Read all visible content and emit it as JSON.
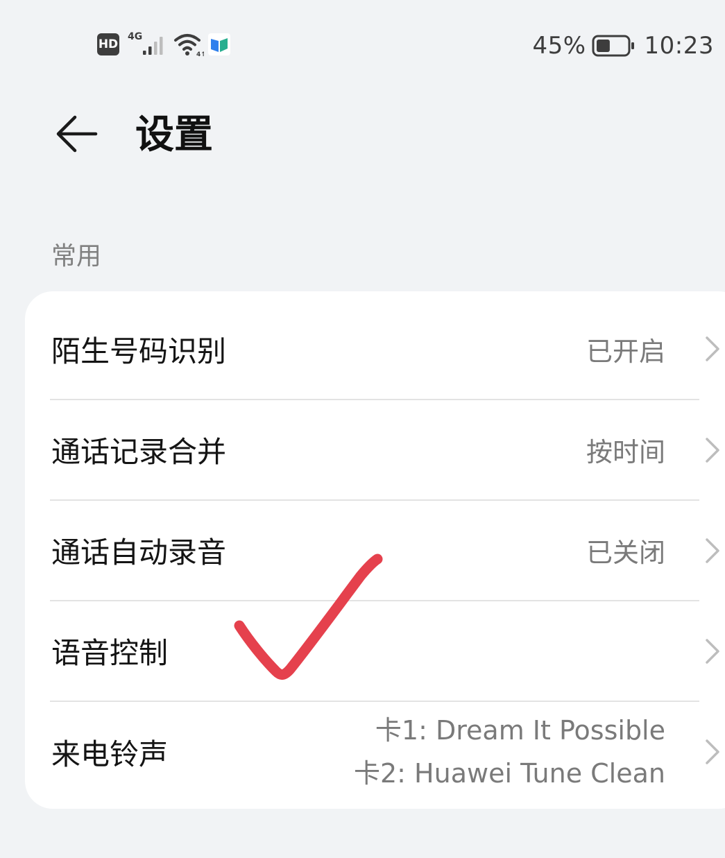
{
  "status_bar": {
    "hd_label": "HD",
    "network_label": "4G",
    "battery_percent": "45%",
    "battery_level": 0.45,
    "time": "10:23"
  },
  "header": {
    "title": "设置"
  },
  "section": {
    "label": "常用",
    "items": [
      {
        "label": "陌生号码识别",
        "value": "已开启"
      },
      {
        "label": "通话记录合并",
        "value": "按时间"
      },
      {
        "label": "通话自动录音",
        "value": "已关闭"
      },
      {
        "label": "语音控制",
        "value": ""
      },
      {
        "label": "来电铃声",
        "value_line1": "卡1: Dream It Possible",
        "value_line2": "卡2: Huawei Tune Clean"
      }
    ]
  },
  "colors": {
    "background": "#f1f3f5",
    "card": "#ffffff",
    "annotation": "#e5414d"
  }
}
